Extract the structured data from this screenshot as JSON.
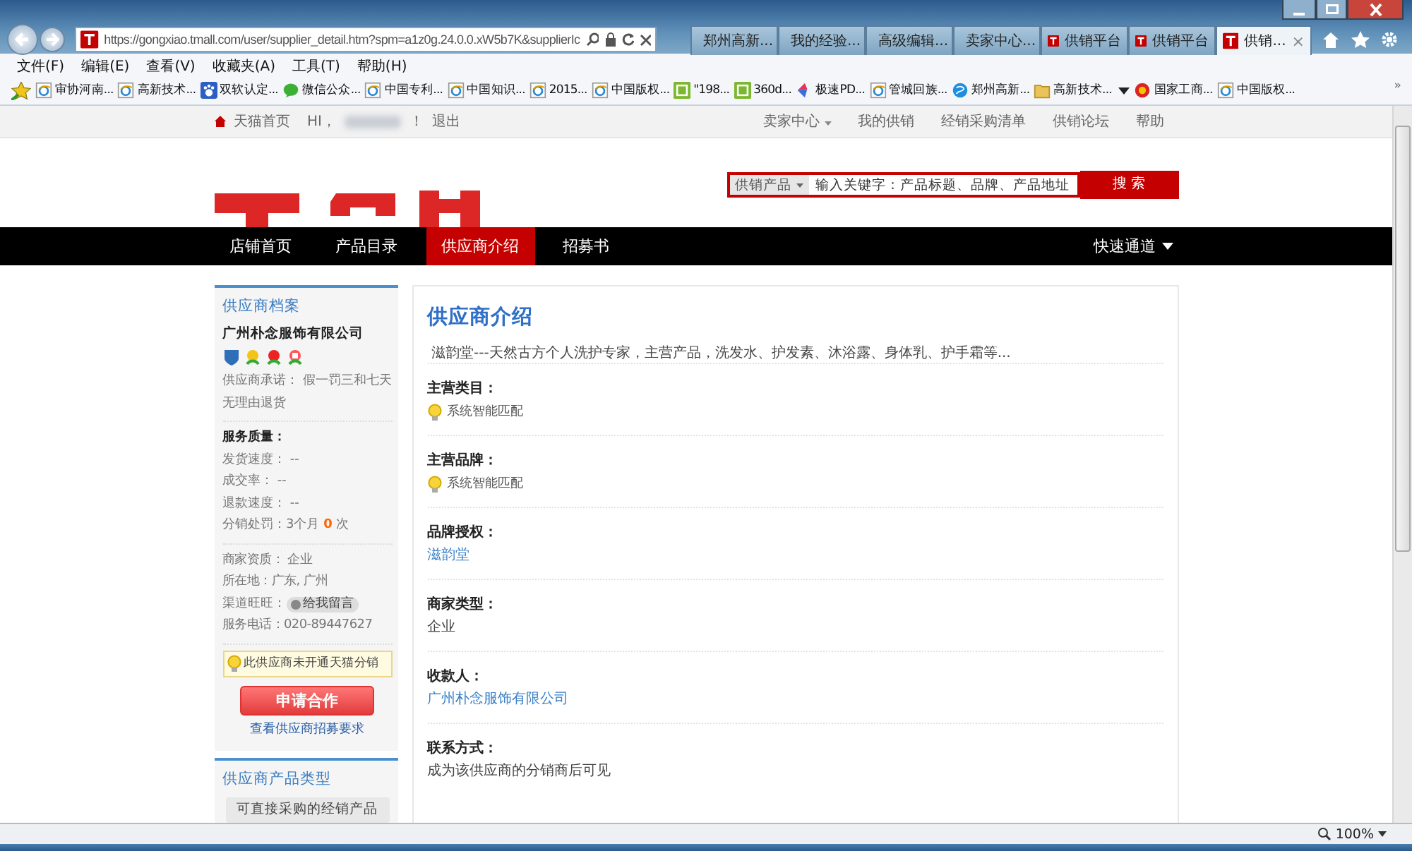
{
  "browser": {
    "url": "https://gongxiao.tmall.com/user/supplier_detail.htm?spm=a1z0g.24.0.0.xW5b7K&supplierIc",
    "tabs": [
      {
        "label": "郑州高新...",
        "selected": false
      },
      {
        "label": "我的经验...",
        "selected": false
      },
      {
        "label": "高级编辑...",
        "selected": false
      },
      {
        "label": "卖家中心...",
        "selected": false
      },
      {
        "label": "供销平台",
        "selected": false
      },
      {
        "label": "供销平台",
        "selected": false
      },
      {
        "label": "供销...",
        "selected": true
      }
    ],
    "close_tab": "×",
    "menu": [
      "文件(F)",
      "编辑(E)",
      "查看(V)",
      "收藏夹(A)",
      "工具(T)",
      "帮助(H)"
    ],
    "favorites": [
      "审协河南...",
      "高新技术...",
      "双软认定...",
      "微信公众...",
      "中国专利...",
      "中国知识...",
      "2015...",
      "中国版权...",
      "\"198...",
      "360d...",
      "极速PD...",
      "管城回族...",
      "郑州高新...",
      "高新技术...",
      "国家工商...",
      "中国版权..."
    ],
    "favorites_more": "»"
  },
  "page": {
    "top_left": {
      "home": "天猫首页",
      "greeting": "HI，",
      "exclaim": "！",
      "logout": "退出"
    },
    "top_right": [
      {
        "label": "卖家中心",
        "dropdown": true
      },
      {
        "label": "我的供销",
        "dropdown": false
      },
      {
        "label": "经销采购清单",
        "dropdown": false
      },
      {
        "label": "供销论坛",
        "dropdown": false
      },
      {
        "label": "帮助",
        "dropdown": false
      }
    ],
    "search": {
      "category": "供销产品",
      "placeholder": "输入关键字：产品标题、品牌、产品地址",
      "button": "搜 索"
    },
    "nav": [
      {
        "label": "店铺首页",
        "selected": false
      },
      {
        "label": "产品目录",
        "selected": false
      },
      {
        "label": "供应商介绍",
        "selected": true
      },
      {
        "label": "招募书",
        "selected": false
      }
    ],
    "quick_access": "快速通道",
    "sidebar": {
      "title": "供应商档案",
      "company": "广州朴念服饰有限公司",
      "commitment": "供应商承诺： 假一罚三和七天无理由退货",
      "quality_title": "服务质量：",
      "quality": [
        "发货速度： --",
        "成交率： --",
        "退款速度： --",
        "分销处罚：3个月 **0** 次"
      ],
      "info": [
        {
          "kind": "text",
          "text": "商家资质： 企业"
        },
        {
          "kind": "text",
          "text": "所在地：广东, 广州"
        },
        {
          "kind": "contact",
          "text": "渠道旺旺：",
          "button": "给我留言"
        },
        {
          "kind": "text",
          "text": "服务电话：020-89447627"
        }
      ],
      "notice": "此供应商未开通天猫分销",
      "apply": "申请合作",
      "requirements": "查看供应商招募要求",
      "product_title": "供应商产品类型",
      "product_button": "可直接采购的经销产品"
    },
    "main": {
      "title": "供应商介绍",
      "intro": "滋韵堂---天然古方个人洗护专家，主营产品，洗发水、护发素、沐浴露、身体乳、护手霜等...",
      "sections": [
        {
          "label": "主营类目：",
          "kind": "hint",
          "value": "系统智能匹配"
        },
        {
          "label": "主营品牌：",
          "kind": "hint",
          "value": "系统智能匹配"
        },
        {
          "label": "品牌授权：",
          "kind": "link",
          "value": "滋韵堂"
        },
        {
          "label": "商家类型：",
          "kind": "text",
          "value": "企业"
        },
        {
          "label": "收款人：",
          "kind": "link",
          "value": "广州朴念服饰有限公司"
        },
        {
          "label": "联系方式：",
          "kind": "text",
          "value": "成为该供应商的分销商后可见"
        }
      ]
    }
  },
  "status_bar": {
    "zoom": "100%"
  }
}
